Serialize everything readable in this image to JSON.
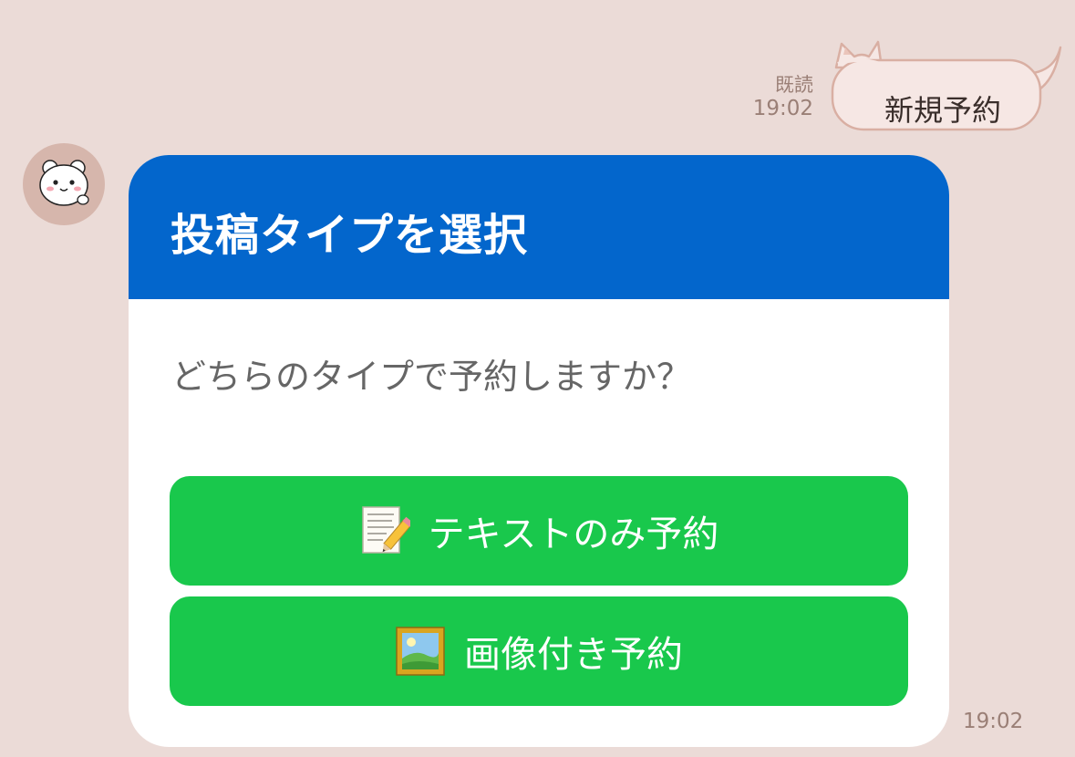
{
  "outgoing": {
    "read_label": "既読",
    "time": "19:02",
    "message": "新規予約"
  },
  "incoming": {
    "avatar_icon": "bear-avatar-icon",
    "card": {
      "title": "投稿タイプを選択",
      "question": "どちらのタイプで予約しますか？",
      "buttons": [
        {
          "icon": "memo-pencil-icon",
          "label": "テキストのみ予約"
        },
        {
          "icon": "framed-picture-icon",
          "label": "画像付き予約"
        }
      ]
    },
    "time": "19:02"
  },
  "colors": {
    "background": "#EBDBD7",
    "header": "#0366CC",
    "button": "#19C84C",
    "bubble": "#F6E7E4",
    "bubble_border": "#D9AFA3"
  }
}
